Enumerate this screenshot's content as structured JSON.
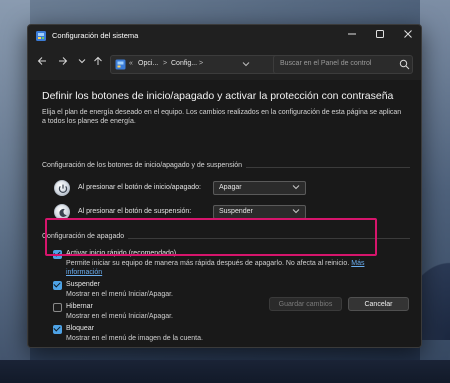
{
  "window": {
    "title": "Configuración del sistema"
  },
  "navbar": {
    "address": {
      "lead": "«",
      "segment1": "Opci...",
      "separator": ">",
      "segment2": "Config..."
    },
    "search_placeholder": "Buscar en el Panel de control"
  },
  "content": {
    "heading": "Definir los botones de inicio/apagado y activar la protección con contraseña",
    "intro": "Elija el plan de energía deseado en el equipo. Los cambios realizados en la configuración de esta página se aplican a todos los planes de energía.",
    "buttons_group": {
      "label": "Configuración de los botones de inicio/apagado y de suspensión",
      "rows": [
        {
          "label": "Al presionar el botón de inicio/apagado:",
          "value": "Apagar"
        },
        {
          "label": "Al presionar el botón de suspensión:",
          "value": "Suspender"
        }
      ]
    },
    "shutdown_group": {
      "label": "Configuración de apagado",
      "items": [
        {
          "label": "Activar inicio rápido (recomendado)",
          "checked": true,
          "desc_line1": "Permite iniciar su equipo de manera más rápida después de apagarlo. No afecta al reinicio.",
          "link_part1": "Más",
          "link_part2": "información"
        },
        {
          "label": "Suspender",
          "checked": true,
          "desc": "Mostrar en el menú Iniciar/Apagar."
        },
        {
          "label": "Hibernar",
          "checked": false,
          "desc": "Mostrar en el menú Iniciar/Apagar."
        },
        {
          "label": "Bloquear",
          "checked": true,
          "desc": "Mostrar en el menú de imagen de la cuenta."
        }
      ]
    }
  },
  "footer": {
    "save_label": "Guardar cambios",
    "cancel_label": "Cancelar"
  },
  "colors": {
    "accent": "#4ea3e6",
    "highlight_frame": "#d6156c",
    "link": "#6aaef0"
  }
}
